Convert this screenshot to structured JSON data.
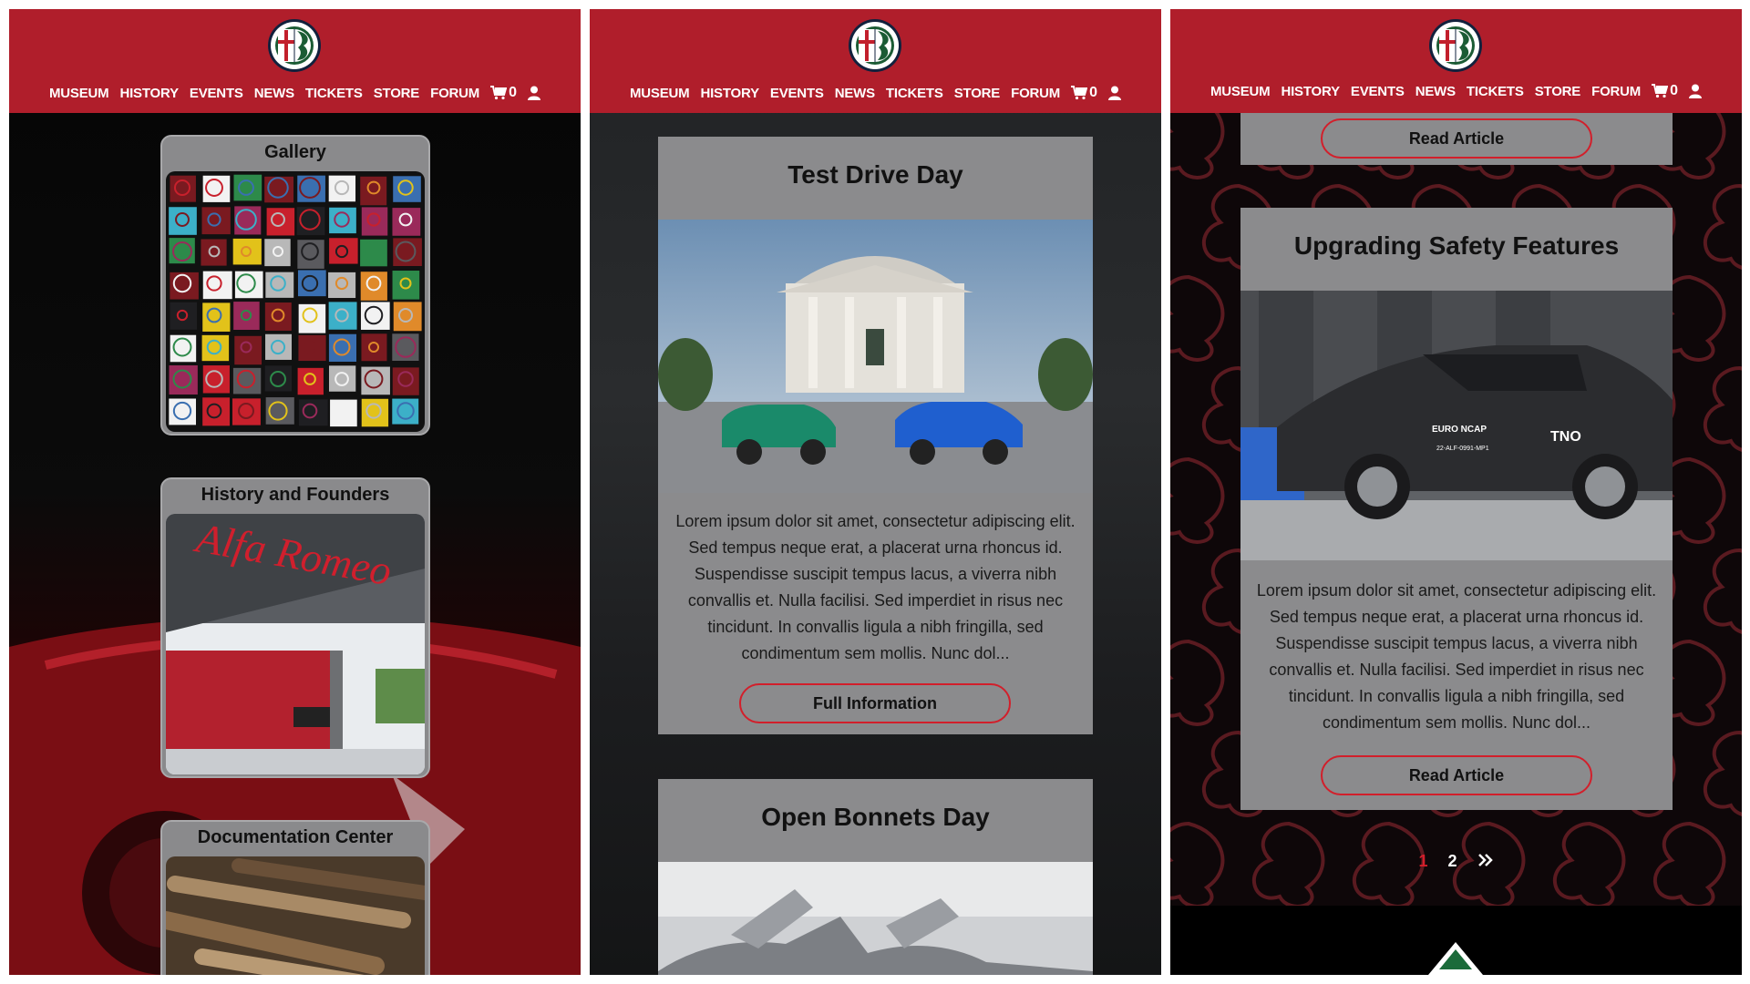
{
  "nav": {
    "items": [
      "MUSEUM",
      "HISTORY",
      "EVENTS",
      "NEWS",
      "TICKETS",
      "STORE",
      "FORUM"
    ],
    "cart_count": "0"
  },
  "panel1": {
    "tiles": [
      {
        "title": "Gallery"
      },
      {
        "title": "History and Founders"
      },
      {
        "title": "Documentation Center"
      }
    ]
  },
  "panel2": {
    "events": [
      {
        "title": "Test Drive Day",
        "text": "Lorem ipsum dolor sit amet, consectetur adipiscing elit. Sed tempus neque erat, a placerat urna rhoncus id. Suspendisse suscipit tempus lacus, a viverra nibh convallis et. Nulla facilisi. Sed imperdiet in risus nec tincidunt. In convallis ligula a nibh fringilla, sed condimentum sem mollis. Nunc dol...",
        "button": "Full Information"
      },
      {
        "title": "Open Bonnets Day"
      }
    ]
  },
  "panel3": {
    "top_button": "Read Article",
    "article": {
      "title": "Upgrading Safety Features",
      "text": "Lorem ipsum dolor sit amet, consectetur adipiscing elit. Sed tempus neque erat, a placerat urna rhoncus id. Suspendisse suscipit tempus lacus, a viverra nibh convallis et. Nulla facilisi. Sed imperdiet in risus nec tincidunt. In convallis ligula a nibh fringilla, sed condimentum sem mollis. Nunc dol...",
      "button": "Read Article",
      "badge1": "EURO NCAP",
      "badge2": "TNO",
      "plate": "22-ALF-0991-MP1"
    },
    "pager": {
      "current": "1",
      "next": "2"
    }
  },
  "colors": {
    "brand_red": "#b01e2b",
    "button_border": "#d21f2b",
    "card_grey": "#8b8b8d"
  },
  "icons": [
    "alfa-romeo-logo-icon",
    "cart-icon",
    "user-icon",
    "double-chevron-right-icon"
  ]
}
